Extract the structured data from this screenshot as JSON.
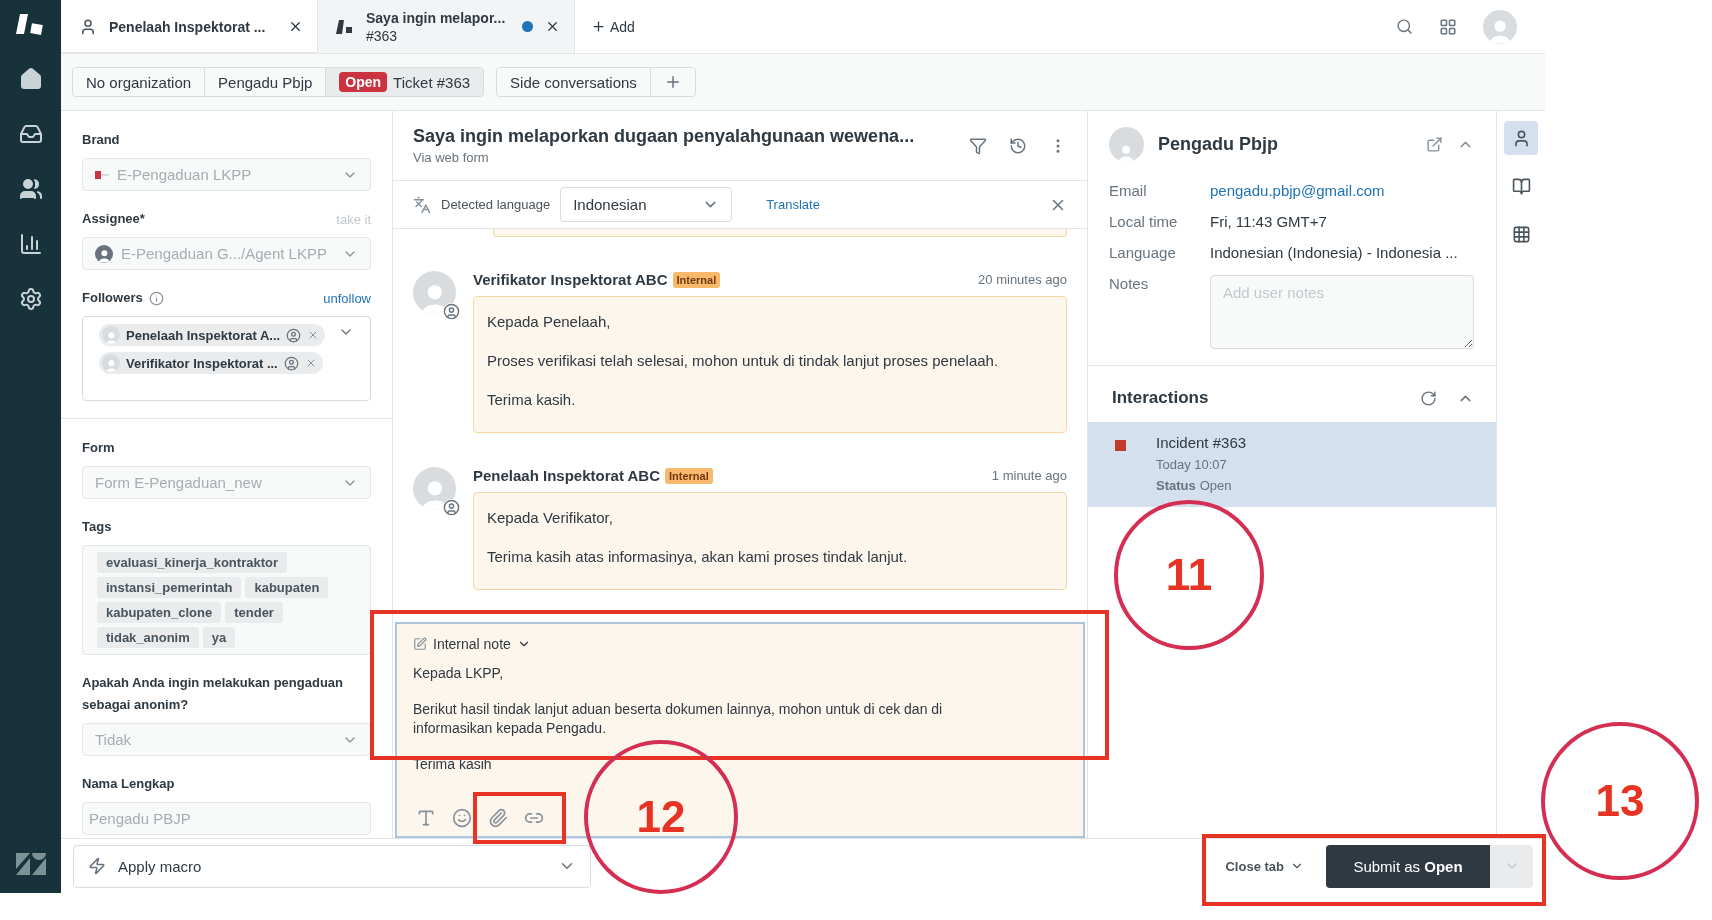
{
  "tabs": [
    {
      "kind": "user",
      "title": "Penelaah Inspektorat ...",
      "selected": false,
      "unsaved": false
    },
    {
      "kind": "ticket",
      "title": "Saya ingin melapor...",
      "subtitle": "#363",
      "selected": true,
      "unsaved": true
    }
  ],
  "add_tab": "Add",
  "breadcrumbs": [
    {
      "label": "No organization",
      "selected": false
    },
    {
      "label": "Pengadu Pbjp",
      "selected": false
    },
    {
      "label": "Ticket #363",
      "badge": "Open",
      "selected": true
    }
  ],
  "side_conversations": "Side conversations",
  "field_sections": [
    [
      {
        "kind": "select",
        "label": "Brand",
        "value": "E-Pengaduan LKPP",
        "disabled": true
      },
      {
        "kind": "select",
        "label": "Assignee*",
        "action": "take it",
        "value": "E-Pengaduan G.../Agent LKPP",
        "disabled": true
      },
      {
        "kind": "followers",
        "label": "Followers",
        "action": "unfollow",
        "followers": [
          "Penelaah Inspektorat A...",
          "Verifikator Inspektorat ..."
        ]
      }
    ],
    [
      {
        "kind": "select",
        "label": "Form",
        "value": "Form E-Pengaduan_new",
        "disabled": true
      },
      {
        "kind": "tags",
        "label": "Tags",
        "tags": [
          "evaluasi_kinerja_kontraktor",
          "instansi_pemerintah",
          "kabupaten",
          "kabupaten_clone",
          "tender",
          "tidak_anonim",
          "ya"
        ]
      },
      {
        "kind": "select",
        "label": "Apakah Anda ingin melakukan pengaduan sebagai anonim?",
        "value": "Tidak",
        "disabled": true
      },
      {
        "kind": "text",
        "label": "Nama Lengkap",
        "value": "Pengadu PBJP",
        "disabled": true
      }
    ]
  ],
  "ticket": {
    "title": "Saya ingin melaporkan dugaan penyalahgunaan wewena...",
    "via": "Via web form"
  },
  "translation": {
    "label": "Detected language",
    "language": "Indonesian",
    "action": "Translate"
  },
  "messages": [
    {
      "author": "Verifikator Inspektorat ABC",
      "badge": "Internal",
      "time": "20 minutes ago",
      "paragraphs": [
        "Kepada Penelaah,",
        "Proses verifikasi telah selesai, mohon untuk di tindak lanjut proses penelaah.",
        "Terima kasih."
      ]
    },
    {
      "author": "Penelaah Inspektorat ABC",
      "badge": "Internal",
      "time": "1 minute ago",
      "paragraphs": [
        "Kepada Verifikator,",
        "Terima kasih atas informasinya, akan kami proses tindak lanjut."
      ]
    }
  ],
  "composer": {
    "mode": "Internal note",
    "paragraphs": [
      "Kepada LKPP,",
      "Berikut hasil tindak lanjut aduan beserta dokumen lainnya, mohon untuk di cek dan di informasikan kepada Pengadu.",
      "Terima kasih"
    ]
  },
  "user": {
    "name": "Pengadu Pbjp",
    "details": [
      {
        "kind": "link",
        "label": "Email",
        "value": "pengadu.pbjp@gmail.com"
      },
      {
        "kind": "text",
        "label": "Local time",
        "value": "Fri, 11:43 GMT+7"
      },
      {
        "kind": "text",
        "label": "Language",
        "value": "Indonesian (Indonesia) - Indonesia ..."
      }
    ],
    "notes_label": "Notes",
    "notes_placeholder": "Add user notes"
  },
  "interactions": {
    "title": "Interactions",
    "items": [
      {
        "title": "Incident #363",
        "time": "Today 10:07",
        "status_label": "Status",
        "status": "Open",
        "color": "#c0392b",
        "selected": true
      }
    ]
  },
  "rail": [
    {
      "kind": "user",
      "selected": true
    },
    {
      "kind": "book",
      "selected": false
    },
    {
      "kind": "apps",
      "selected": false
    }
  ],
  "footer": {
    "macro": "Apply macro",
    "close_tab": "Close tab",
    "submit": "Submit as **Open**"
  },
  "annotations": [
    {
      "kind": "rect"
    },
    {
      "kind": "rect"
    },
    {
      "kind": "circle",
      "label": "11"
    },
    {
      "kind": "circle",
      "label": "12"
    },
    {
      "kind": "circle",
      "label": "13"
    },
    {
      "kind": "rect"
    }
  ]
}
